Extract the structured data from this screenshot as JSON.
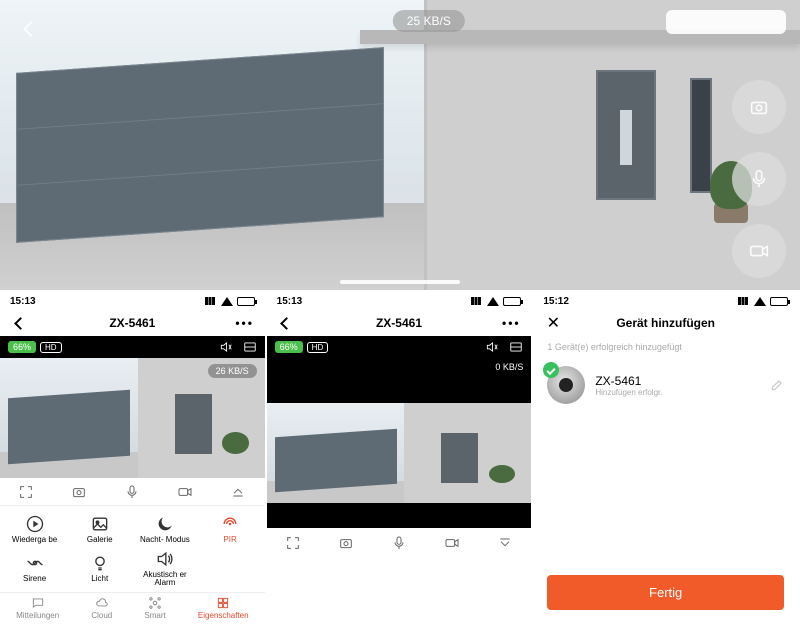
{
  "hero": {
    "bitrate": "25 KB/S",
    "side_buttons": [
      "snapshot-icon",
      "mic-icon",
      "record-icon"
    ]
  },
  "pane1": {
    "time": "15:13",
    "title": "ZX-5461",
    "battery": "66%",
    "quality": "HD",
    "bitrate": "26 KB/S",
    "grid": [
      {
        "key": "playback",
        "label": "Wiederga\nbe"
      },
      {
        "key": "gallery",
        "label": "Galerie"
      },
      {
        "key": "night",
        "label": "Nacht-\nModus"
      },
      {
        "key": "pir",
        "label": "PIR"
      },
      {
        "key": "siren",
        "label": "Sirene"
      },
      {
        "key": "light",
        "label": "Licht"
      },
      {
        "key": "acoustic",
        "label": "Akustisch\ner Alarm"
      }
    ],
    "tabs": [
      {
        "key": "messages",
        "label": "Mitteilungen"
      },
      {
        "key": "cloud",
        "label": "Cloud"
      },
      {
        "key": "smart",
        "label": "Smart"
      },
      {
        "key": "properties",
        "label": "Eigenschaften"
      }
    ],
    "active_tab": "properties"
  },
  "pane2": {
    "time": "15:13",
    "title": "ZX-5461",
    "battery": "66%",
    "quality": "HD",
    "bitrate": "0 KB/S"
  },
  "pane3": {
    "time": "15:12",
    "title": "Gerät hinzufügen",
    "subtitle": "1 Gerät(e) erfolgreich hinzugefügt",
    "device_name": "ZX-5461",
    "device_status": "Hinzufügen erfolgr.",
    "done": "Fertig"
  }
}
